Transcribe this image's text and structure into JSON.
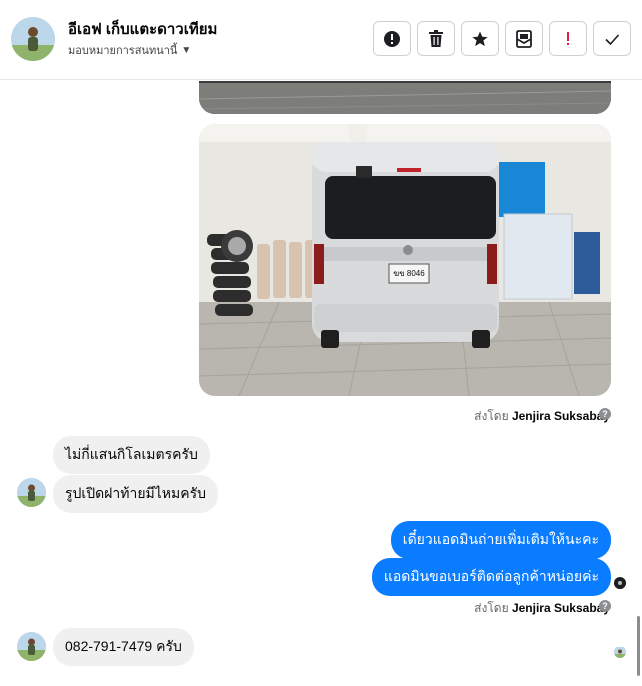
{
  "header": {
    "contact_name": "อีเอฟ เก็บแตะดาวเทียม",
    "assign_label": "มอบหมายการสนทนานี้",
    "actions": [
      "report",
      "delete",
      "star",
      "mark-unread",
      "spam",
      "done"
    ]
  },
  "thread": {
    "sent_by_prefix": "ส่งโดย",
    "sent_by_name": "Jenjira Suksabay",
    "messages": {
      "in1": "ไม่กี่แสนกิโลเมตรครับ",
      "in2": "รูปเปิดฝาท้ายมีไหมครับ",
      "out1": "เดี๋ยวแอดมินถ่ายเพิ่มเติมให้นะคะ",
      "out2": "แอดมินขอเบอร์ติดต่อลูกค้าหน่อยค่ะ",
      "in3": "082-791-7479 ครับ"
    },
    "photo": {
      "plate_text": "ฆข 8046"
    }
  },
  "colors": {
    "outgoing": "#0a7cff",
    "incoming": "#f0f0f0",
    "muted": "#65676b"
  }
}
